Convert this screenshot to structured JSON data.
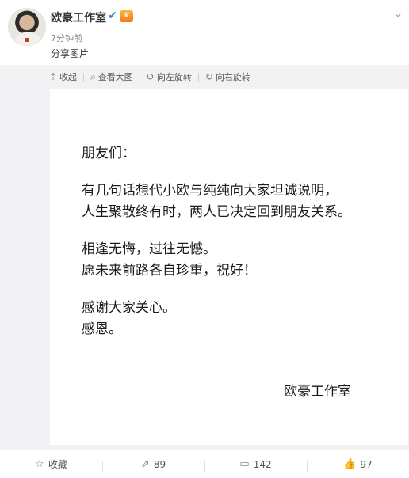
{
  "post": {
    "author": "欧豪工作室",
    "time": "7分钟前",
    "text": "分享图片",
    "verified_icon": "verified-badge-icon",
    "vip_icon": "vip-crown-icon",
    "vip_text": "♛",
    "verify_glyph": "✔",
    "more_glyph": "⌄"
  },
  "toolbar": {
    "collapse": "收起",
    "view_large": "查看大图",
    "rotate_left": "向左旋转",
    "rotate_right": "向右旋转",
    "collapse_glyph": "⇡",
    "view_glyph": "⌕",
    "rotate_left_glyph": "↺",
    "rotate_right_glyph": "↻"
  },
  "letter": {
    "greeting": "朋友们：",
    "p1_l1": "有几句话想代小欧与纯纯向大家坦诚说明，",
    "p1_l2": "人生聚散终有时，两人已决定回到朋友关系。",
    "p2_l1": "相逢无悔，过往无憾。",
    "p2_l2": "愿未来前路各自珍重，祝好！",
    "p3_l1": "感谢大家关心。",
    "p3_l2": "感恩。",
    "signature": "欧豪工作室"
  },
  "footer": {
    "favorite": "收藏",
    "repost": "89",
    "comment": "142",
    "like": "97",
    "favorite_glyph": "☆",
    "repost_glyph": "⇗",
    "comment_glyph": "▭",
    "like_glyph": "👍"
  }
}
